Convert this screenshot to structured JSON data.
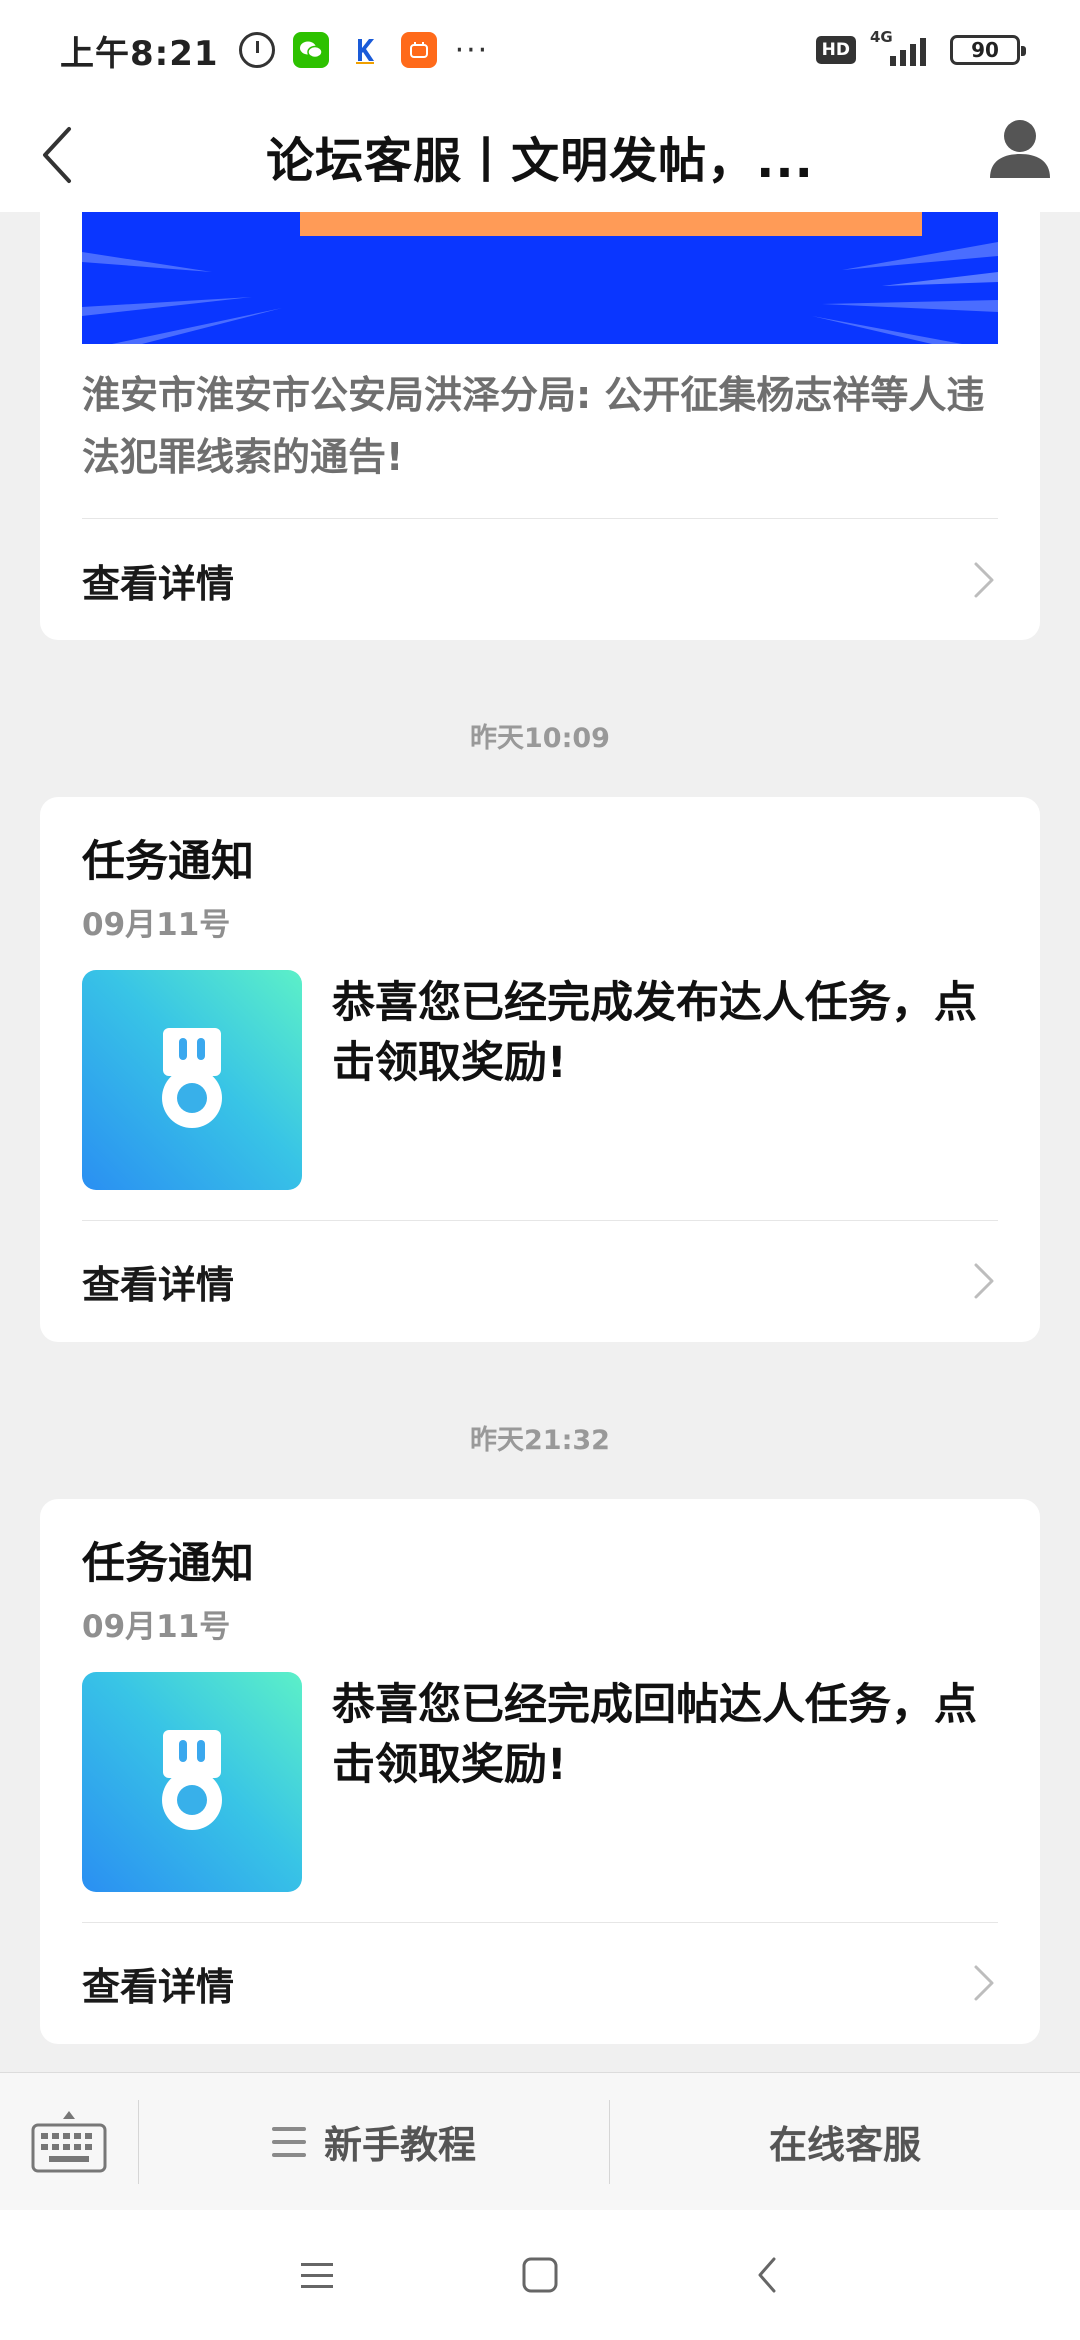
{
  "status_bar": {
    "time": "上午8:21",
    "more": "···",
    "hd": "HD",
    "network": "4G",
    "battery": "90"
  },
  "nav": {
    "title": "论坛客服丨文明发帖，..."
  },
  "messages": [
    {
      "text": "淮安市淮安市公安局洪泽分局: 公开征集杨志祥等人违法犯罪线索的通告!",
      "detail_label": "查看详情"
    },
    {
      "timestamp": "昨天10:09",
      "title": "任务通知",
      "date": "09月11号",
      "text": "恭喜您已经完成发布达人任务，点击领取奖励!",
      "detail_label": "查看详情",
      "thumbnail_icon": "medal-icon"
    },
    {
      "timestamp": "昨天21:32",
      "title": "任务通知",
      "date": "09月11号",
      "text": "恭喜您已经完成回帖达人任务，点击领取奖励!",
      "detail_label": "查看详情",
      "thumbnail_icon": "medal-icon"
    }
  ],
  "bottom_menu": {
    "items": [
      {
        "label": "新手教程",
        "icon": "menu-icon"
      },
      {
        "label": "在线客服"
      }
    ]
  },
  "colors": {
    "banner_blue": "#0a36ff",
    "banner_orange": "#ff9b57",
    "thumb_gradient_start": "#2a8ff2",
    "thumb_gradient_end": "#5cf0c8"
  }
}
